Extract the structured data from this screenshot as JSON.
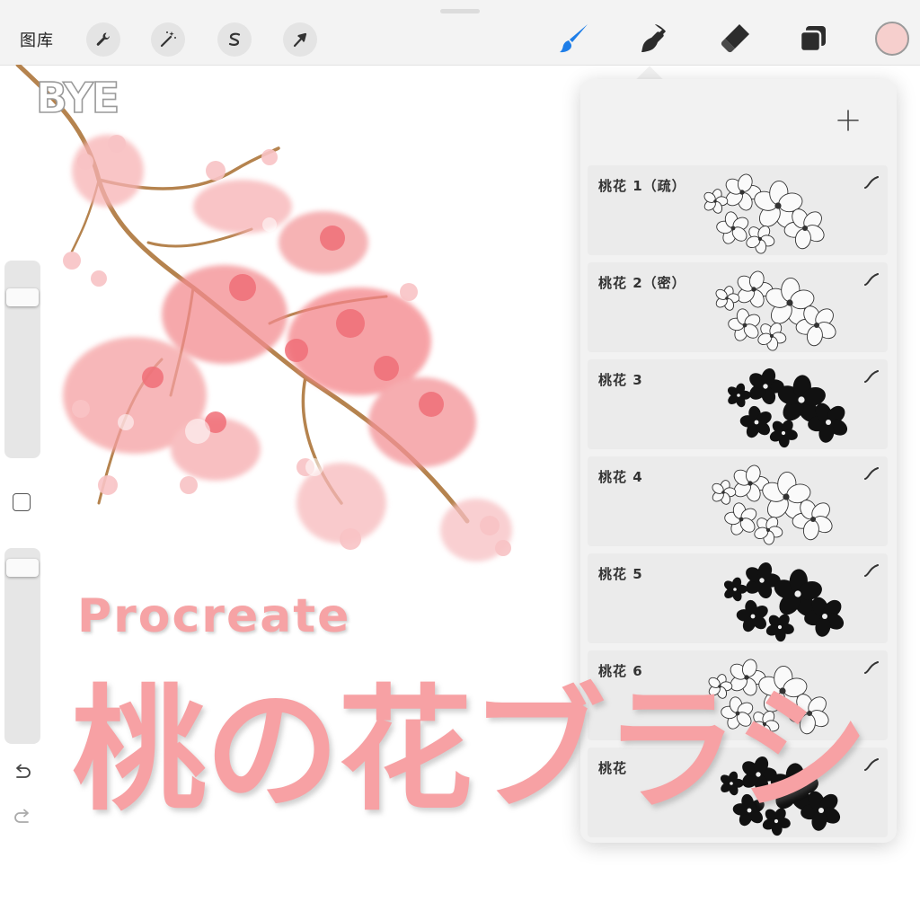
{
  "toolbar": {
    "gallery_label": "图库",
    "left_tools": [
      {
        "name": "actions-wrench-icon"
      },
      {
        "name": "adjustments-wand-icon"
      },
      {
        "name": "selection-s-icon"
      },
      {
        "name": "transform-arrow-icon"
      }
    ],
    "right_tools": [
      {
        "name": "brush-icon",
        "active": true,
        "color": "#1e7ee8"
      },
      {
        "name": "smudge-icon"
      },
      {
        "name": "eraser-icon"
      },
      {
        "name": "layers-icon"
      }
    ],
    "current_color": "#f6cfcd"
  },
  "sidebar": {
    "brush_size_level": 0.15,
    "opacity_level": 0.05,
    "undo_icon": "undo-arrow-icon",
    "redo_icon": "redo-arrow-icon"
  },
  "canvas": {
    "watermark": "BYE",
    "subtitle": "Procreate",
    "title": "桃の花ブラシ",
    "title_color": "#f7a1a4"
  },
  "brush_library": {
    "add_icon": "plus-icon",
    "brushes": [
      {
        "name": "桃花 1（疏）",
        "style": "outline"
      },
      {
        "name": "桃花 2（密）",
        "style": "outline"
      },
      {
        "name": "桃花 3",
        "style": "solid"
      },
      {
        "name": "桃花 4",
        "style": "outline"
      },
      {
        "name": "桃花 5",
        "style": "solid"
      },
      {
        "name": "桃花 6",
        "style": "outline"
      },
      {
        "name": "桃花",
        "style": "solid"
      }
    ]
  }
}
